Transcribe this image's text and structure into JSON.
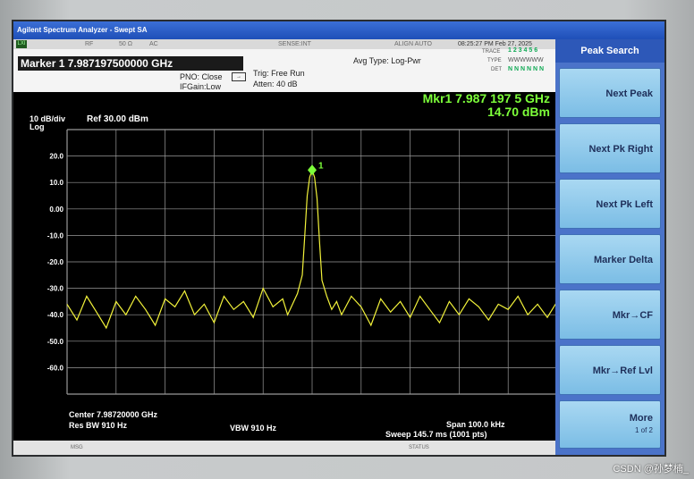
{
  "window": {
    "title": "Agilent Spectrum Analyzer - Swept SA"
  },
  "status": {
    "lxi": "LXI",
    "rf": "RF",
    "impedance": "50 Ω",
    "coupling": "AC",
    "sense": "SENSE:INT",
    "align": "ALIGN AUTO",
    "datetime": "08:25:27 PM Feb 27, 2025",
    "trace_label": "TRACE",
    "trace_values": "1 2 3 4 5 6",
    "type_label": "TYPE",
    "type_values": "WWWWWW",
    "det_label": "DET",
    "det_values": "N N N N N N"
  },
  "info": {
    "marker_title": "Marker 1  7.987197500000 GHz",
    "pno": "PNO: Close",
    "ifgain": "IFGain:Low",
    "trig": "Trig: Free Run",
    "atten": "Atten: 40 dB",
    "avg_type": "Avg Type: Log-Pwr"
  },
  "plot": {
    "mkr_line1": "Mkr1 7.987 197 5 GHz",
    "mkr_line2": "14.70 dBm",
    "scale_per_div": "10 dB/div",
    "scale_type": "Log",
    "ref_level": "Ref 30.00 dBm",
    "marker_label": "1",
    "center": "Center 7.98720000 GHz",
    "res_bw": "Res BW 910 Hz",
    "vbw": "VBW 910 Hz",
    "span": "Span 100.0 kHz",
    "sweep": "Sweep  145.7 ms (1001 pts)"
  },
  "msg": {
    "left": "MSG",
    "center": "STATUS"
  },
  "softkeys": {
    "title": "Peak Search",
    "items": [
      "Next Peak",
      "Next Pk Right",
      "Next Pk Left",
      "Marker Delta",
      "Mkr→CF",
      "Mkr→Ref Lvl",
      "More"
    ],
    "more_page": "1 of 2"
  },
  "watermark": "CSDN @孙梦楠_",
  "chart_data": {
    "type": "line",
    "ylabel": "dBm",
    "ylim": [
      -70,
      30
    ],
    "y_ticks": [
      "20.0",
      "10.0",
      "0.00",
      "-10.0",
      "-20.0",
      "-30.0",
      "-40.0",
      "-50.0",
      "-60.0"
    ],
    "x": [
      0,
      2,
      4,
      6,
      8,
      10,
      12,
      14,
      16,
      18,
      20,
      22,
      24,
      26,
      28,
      30,
      32,
      34,
      36,
      38,
      40,
      42,
      44,
      45,
      46,
      47,
      48,
      48.5,
      49,
      49.5,
      50,
      50.5,
      51,
      51.5,
      52,
      53,
      54,
      55,
      56,
      58,
      60,
      62,
      64,
      66,
      68,
      70,
      72,
      74,
      76,
      78,
      80,
      82,
      84,
      86,
      88,
      90,
      92,
      94,
      96,
      98,
      100
    ],
    "series": [
      {
        "values": [
          -36,
          -42,
          -33,
          -39,
          -45,
          -35,
          -40,
          -33,
          -38,
          -44,
          -34,
          -37,
          -31,
          -40,
          -36,
          -43,
          -33,
          -38,
          -35,
          -41,
          -30,
          -37,
          -34,
          -40,
          -36,
          -32,
          -25,
          -10,
          5,
          12,
          14.7,
          12,
          4,
          -12,
          -27,
          -33,
          -38,
          -35,
          -40,
          -33,
          -37,
          -44,
          -34,
          -39,
          -35,
          -41,
          -33,
          -38,
          -43,
          -35,
          -40,
          -34,
          -37,
          -42,
          -36,
          -38,
          -33,
          -40,
          -36,
          -41,
          -35
        ]
      }
    ],
    "marker": {
      "x": 50,
      "y": 14.7
    }
  }
}
